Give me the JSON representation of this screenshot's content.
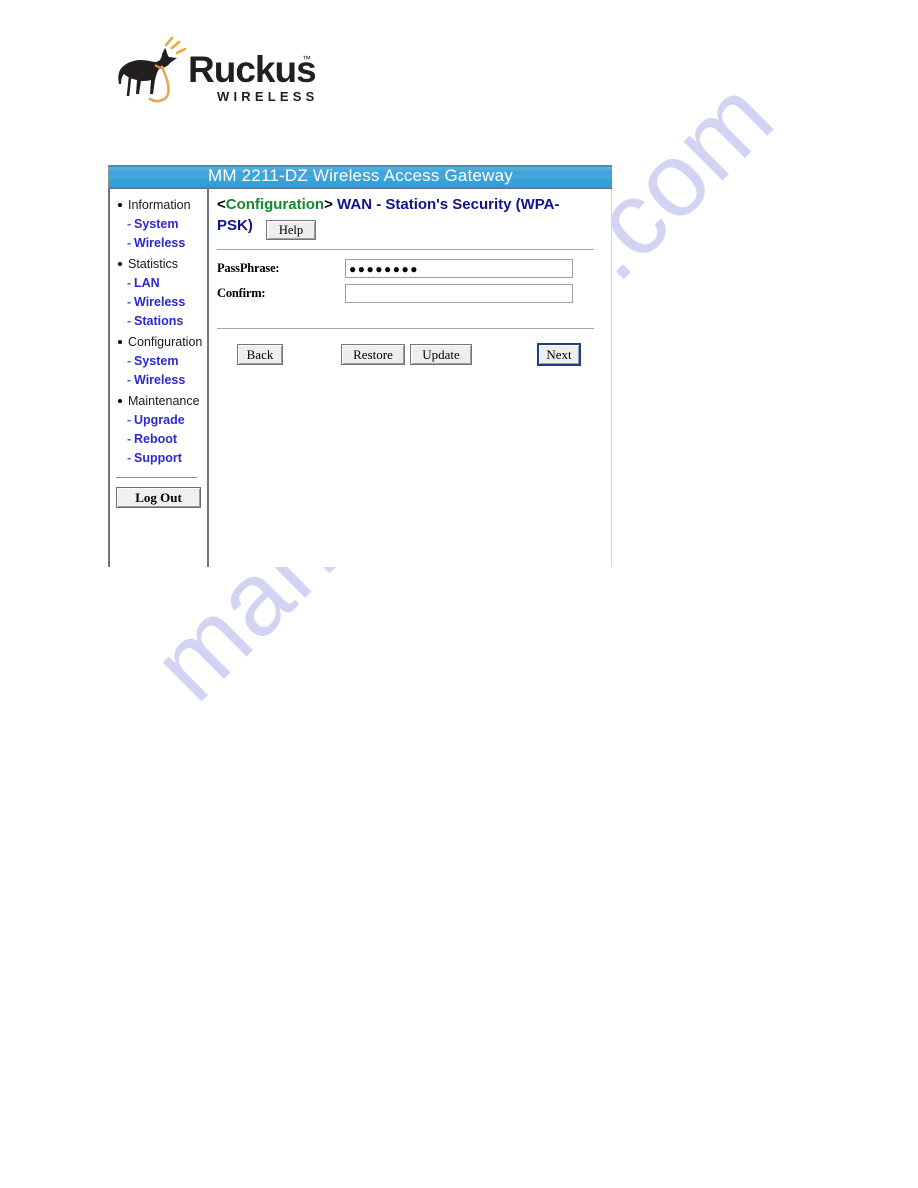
{
  "logo": {
    "brand": "Ruckus",
    "tagline": "WIRELESS",
    "trademark": "™",
    "mark_name": "ruckus-dog-logo"
  },
  "window": {
    "title": "MM 2211-DZ Wireless Access Gateway"
  },
  "sidebar": {
    "groups": [
      {
        "label": "Information",
        "items": [
          {
            "label": "System"
          },
          {
            "label": "Wireless"
          }
        ]
      },
      {
        "label": "Statistics",
        "items": [
          {
            "label": "LAN"
          },
          {
            "label": "Wireless"
          },
          {
            "label": "Stations"
          }
        ]
      },
      {
        "label": "Configuration",
        "items": [
          {
            "label": "System"
          },
          {
            "label": "Wireless"
          }
        ]
      },
      {
        "label": "Maintenance",
        "items": [
          {
            "label": "Upgrade"
          },
          {
            "label": "Reboot"
          },
          {
            "label": "Support"
          }
        ]
      }
    ],
    "dash": "-",
    "logout_label": "Log Out"
  },
  "heading": {
    "open_angle": "<",
    "section": "Configuration",
    "close_angle": ">",
    "main": " WAN - Station's Security (WPA-PSK)",
    "help_label": "Help"
  },
  "form": {
    "passphrase": {
      "label": "PassPhrase:",
      "value": "●●●●●●●●",
      "placeholder": ""
    },
    "confirm": {
      "label": "Confirm:",
      "value": "",
      "placeholder": ""
    }
  },
  "buttons": {
    "back": "Back",
    "restore": "Restore",
    "update": "Update",
    "next": "Next"
  },
  "watermark": {
    "text": "manualshive.com",
    "color": "#ccccf2"
  },
  "colors": {
    "title_bar_blue": "#37a3da",
    "link_blue": "#2a2ad0",
    "heading_navy": "#12128c",
    "section_green": "#128a2c",
    "focus_border": "#1e3c8c"
  }
}
